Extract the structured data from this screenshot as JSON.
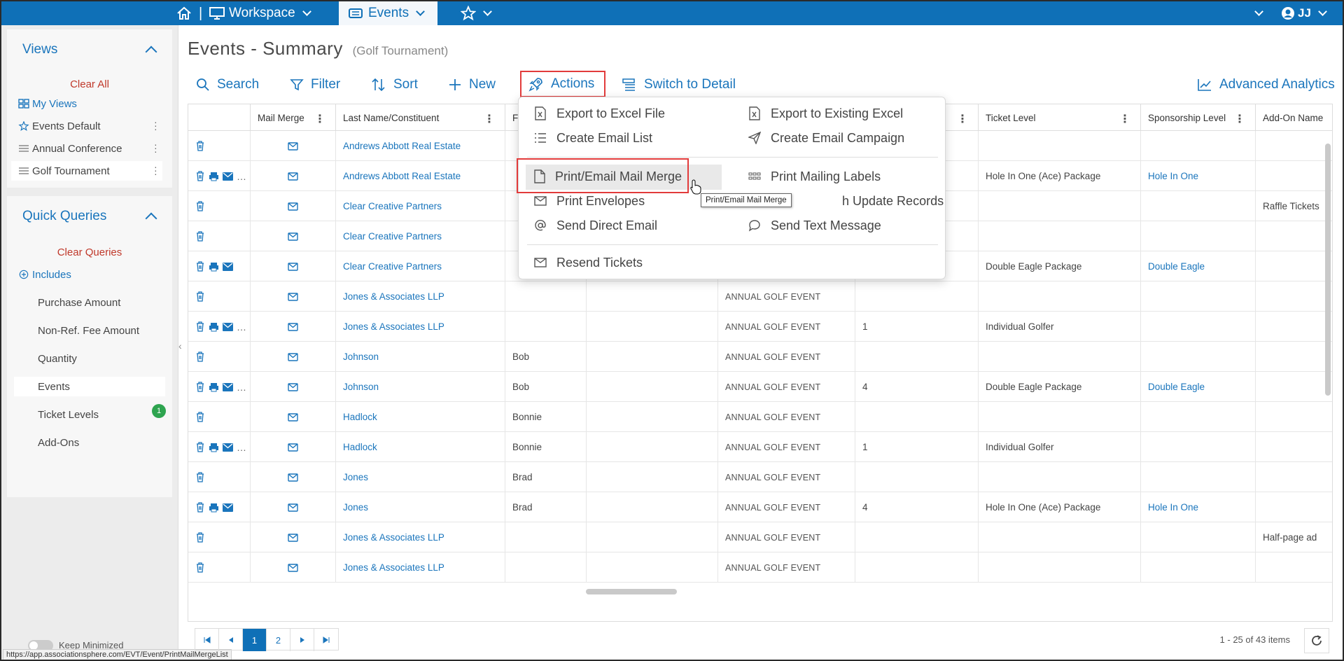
{
  "topbar": {
    "workspace_label": "Workspace",
    "events_label": "Events",
    "user_initials": "JJ"
  },
  "sidebar": {
    "views_title": "Views",
    "clear_all": "Clear All",
    "view_items": [
      "My Views",
      "Events Default",
      "Annual Conference",
      "Golf Tournament"
    ],
    "quick_queries_title": "Quick Queries",
    "clear_queries": "Clear Queries",
    "includes": "Includes",
    "query_items": [
      "Purchase Amount",
      "Non-Ref. Fee Amount",
      "Quantity",
      "Events",
      "Ticket Levels",
      "Add-Ons"
    ],
    "events_badge": "1",
    "keep_minimized": "Keep Minimized"
  },
  "status_url": "https://app.associationsphere.com/EVT/Event/PrintMailMergeList",
  "page": {
    "title": "Events - Summary",
    "subtitle": "(Golf Tournament)"
  },
  "toolbar": {
    "search": "Search",
    "filter": "Filter",
    "sort": "Sort",
    "new": "New",
    "actions": "Actions",
    "switch": "Switch to Detail",
    "analytics": "Advanced Analytics"
  },
  "grid": {
    "headers": {
      "mail_merge": "Mail Merge",
      "last_name": "Last Name/Constituent",
      "first": "Fi",
      "ticket_level": "Ticket Level",
      "sponsorship": "Sponsorship Level",
      "addon": "Add-On Name"
    },
    "rows": [
      {
        "icons": "d",
        "name": "Andrews Abbott Real Estate",
        "first": "",
        "event": "",
        "qty": "",
        "ticket": "",
        "sponsor": "",
        "addon": ""
      },
      {
        "icons": "dpe.",
        "name": "Andrews Abbott Real Estate",
        "first": "",
        "event": "",
        "qty": "",
        "ticket": "Hole In One (Ace) Package",
        "sponsor": "Hole In One",
        "addon": ""
      },
      {
        "icons": "d",
        "name": "Clear Creative Partners",
        "first": "",
        "event": "",
        "qty": "",
        "ticket": "",
        "sponsor": "",
        "addon": "Raffle Tickets"
      },
      {
        "icons": "d",
        "name": "Clear Creative Partners",
        "first": "",
        "event": "",
        "qty": "",
        "ticket": "",
        "sponsor": "",
        "addon": ""
      },
      {
        "icons": "dpe",
        "name": "Clear Creative Partners",
        "first": "",
        "event": "",
        "qty": "",
        "ticket": "Double Eagle Package",
        "sponsor": "Double Eagle",
        "addon": ""
      },
      {
        "icons": "d",
        "name": "Jones & Associates LLP",
        "first": "",
        "event": "ANNUAL GOLF EVENT",
        "qty": "",
        "ticket": "",
        "sponsor": "",
        "addon": ""
      },
      {
        "icons": "dpe.",
        "name": "Jones & Associates LLP",
        "first": "",
        "event": "ANNUAL GOLF EVENT",
        "qty": "1",
        "ticket": "Individual Golfer",
        "sponsor": "",
        "addon": ""
      },
      {
        "icons": "d",
        "name": "Johnson",
        "first": "Bob",
        "event": "ANNUAL GOLF EVENT",
        "qty": "",
        "ticket": "",
        "sponsor": "",
        "addon": ""
      },
      {
        "icons": "dpe.",
        "name": "Johnson",
        "first": "Bob",
        "event": "ANNUAL GOLF EVENT",
        "qty": "4",
        "ticket": "Double Eagle Package",
        "sponsor": "Double Eagle",
        "addon": ""
      },
      {
        "icons": "d",
        "name": "Hadlock",
        "first": "Bonnie",
        "event": "ANNUAL GOLF EVENT",
        "qty": "",
        "ticket": "",
        "sponsor": "",
        "addon": ""
      },
      {
        "icons": "dpe.",
        "name": "Hadlock",
        "first": "Bonnie",
        "event": "ANNUAL GOLF EVENT",
        "qty": "1",
        "ticket": "Individual Golfer",
        "sponsor": "",
        "addon": ""
      },
      {
        "icons": "d",
        "name": "Jones",
        "first": "Brad",
        "event": "ANNUAL GOLF EVENT",
        "qty": "",
        "ticket": "",
        "sponsor": "",
        "addon": ""
      },
      {
        "icons": "dpe",
        "name": "Jones",
        "first": "Brad",
        "event": "ANNUAL GOLF EVENT",
        "qty": "4",
        "ticket": "Hole In One (Ace) Package",
        "sponsor": "Hole In One",
        "addon": ""
      },
      {
        "icons": "d",
        "name": "Jones & Associates LLP",
        "first": "",
        "event": "ANNUAL GOLF EVENT",
        "qty": "",
        "ticket": "",
        "sponsor": "",
        "addon": "Half-page ad"
      },
      {
        "icons": "d",
        "name": "Jones & Associates LLP",
        "first": "",
        "event": "ANNUAL GOLF EVENT",
        "qty": "",
        "ticket": "",
        "sponsor": "",
        "addon": ""
      }
    ]
  },
  "pager": {
    "pages": [
      "1",
      "2"
    ],
    "info": "1 - 25 of 43 items"
  },
  "dropdown": {
    "export_excel": "Export to Excel File",
    "export_existing": "Export to Existing Excel",
    "create_email_list": "Create Email List",
    "create_campaign": "Create Email Campaign",
    "print_mail_merge": "Print/Email Mail Merge",
    "print_labels": "Print Mailing Labels",
    "print_envelopes": "Print Envelopes",
    "batch_update": "h Update Records",
    "send_direct": "Send Direct Email",
    "send_text": "Send Text Message",
    "resend": "Resend Tickets"
  },
  "tooltip": "Print/Email Mail Merge",
  "colors": {
    "brand": "#0f70b7",
    "link": "#1a75bc",
    "highlight": "#e23b3b",
    "badge": "#2ea44f"
  }
}
